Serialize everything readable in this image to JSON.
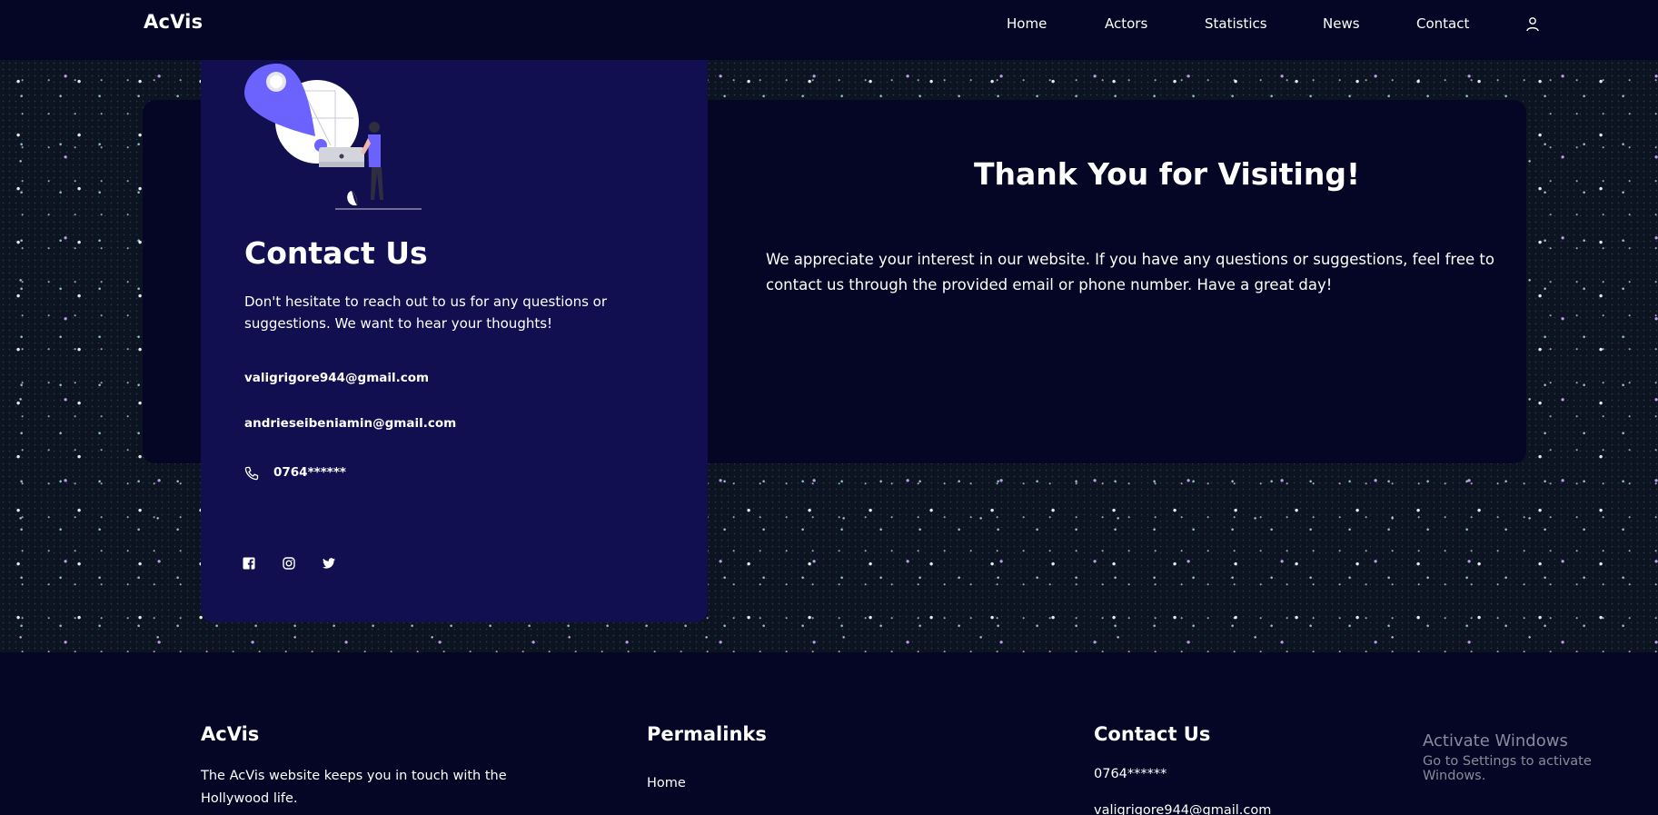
{
  "navbar": {
    "brand": "AcVis",
    "links": [
      "Home",
      "Actors",
      "Statistics",
      "News",
      "Contact"
    ],
    "user_icon": "user-icon"
  },
  "contact_card": {
    "illustration": "location-pin-person-laptop-illustration",
    "title": "Contact Us",
    "description": "Don't hesitate to reach out to us for any questions or suggestions. We want to hear your thoughts!",
    "emails": [
      "valigrigore944@gmail.com",
      "andrieseibeniamin@gmail.com"
    ],
    "phone": "0764******",
    "phone_icon": "phone-icon",
    "social_icons": [
      "facebook-icon",
      "instagram-icon",
      "twitter-icon"
    ]
  },
  "thanks": {
    "title": "Thank You for Visiting!",
    "text": "We appreciate your interest in our website. If you have any questions or suggestions, feel free to contact us through the provided email or phone number. Have a great day!"
  },
  "footer": {
    "about": {
      "title": "AcVis",
      "text": "The AcVis website keeps you in touch with the Hollywood life."
    },
    "permalinks": {
      "title": "Permalinks",
      "links": [
        "Home"
      ]
    },
    "contact": {
      "title": "Contact Us",
      "items": [
        "0764******",
        "valigrigore944@gmail.com"
      ]
    }
  },
  "watermark": {
    "line1": "Activate Windows",
    "line2": "Go to Settings to activate Windows."
  },
  "colors": {
    "page_bg": "#050526",
    "card_bg": "#110f4f",
    "accent": "#6c63ff"
  }
}
